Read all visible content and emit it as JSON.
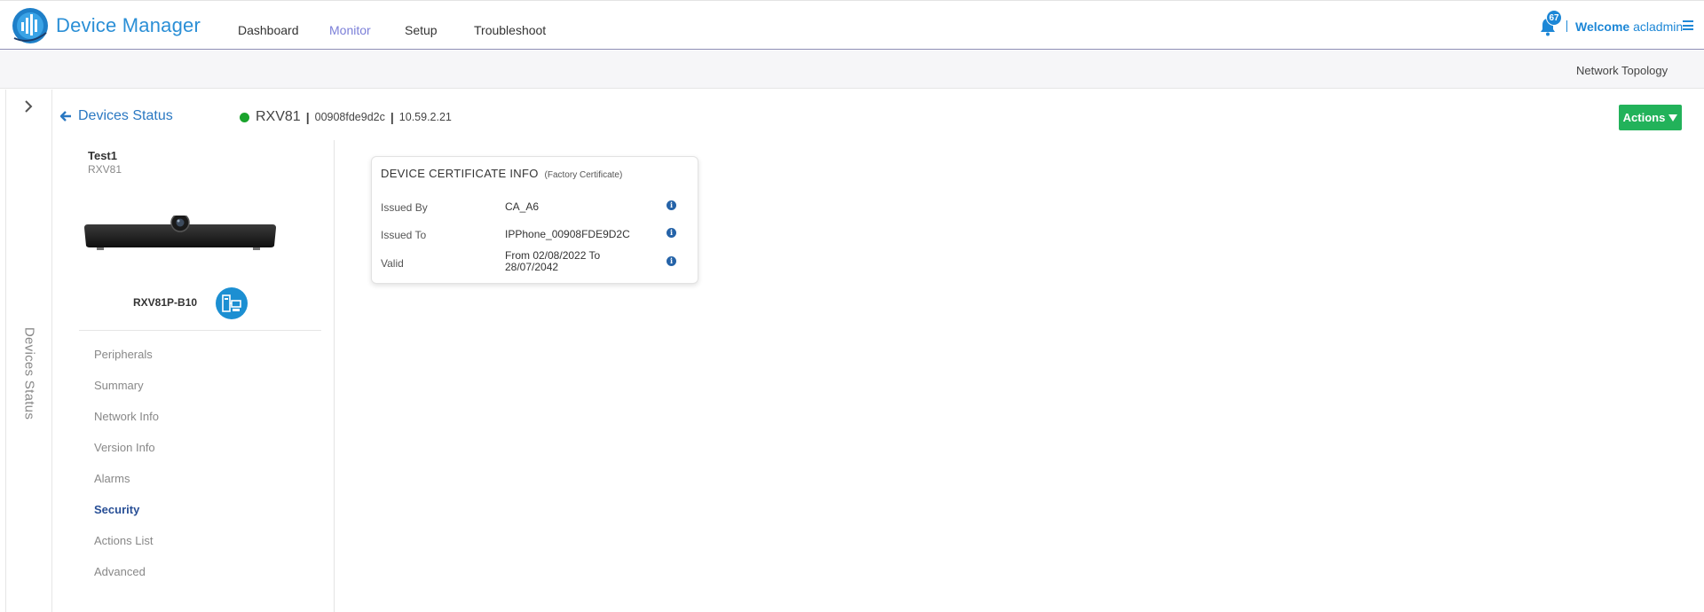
{
  "app": {
    "title": "Device Manager"
  },
  "nav": [
    {
      "label": "Dashboard",
      "active": false
    },
    {
      "label": "Monitor",
      "active": true
    },
    {
      "label": "Setup",
      "active": false
    },
    {
      "label": "Troubleshoot",
      "active": false
    }
  ],
  "header": {
    "notification_count": "67",
    "welcome_prefix": "Welcome",
    "username": "acladmin"
  },
  "subbar": {
    "network_topology": "Network Topology"
  },
  "rail": {
    "label": "Devices Status"
  },
  "page": {
    "back_label": "Devices Status",
    "device_name": "RXV81",
    "mac": "00908fde9d2c",
    "ip": "10.59.2.21",
    "status_color": "#1aa32c",
    "actions_label": "Actions"
  },
  "device": {
    "label": "Test1",
    "model_short": "RXV81",
    "model_full": "RXV81P-B10"
  },
  "menu": [
    {
      "label": "Peripherals",
      "active": false
    },
    {
      "label": "Summary",
      "active": false
    },
    {
      "label": "Network Info",
      "active": false
    },
    {
      "label": "Version Info",
      "active": false
    },
    {
      "label": "Alarms",
      "active": false
    },
    {
      "label": "Security",
      "active": true
    },
    {
      "label": "Actions List",
      "active": false
    },
    {
      "label": "Advanced",
      "active": false
    }
  ],
  "certificate": {
    "title": "DEVICE CERTIFICATE INFO",
    "subtitle": "(Factory Certificate)",
    "rows": [
      {
        "key": "Issued By",
        "value": "CA_A6"
      },
      {
        "key": "Issued To",
        "value": "IPPhone_00908FDE9D2C"
      },
      {
        "key": "Valid",
        "value": "From 02/08/2022 To 28/07/2042"
      }
    ]
  },
  "colors": {
    "brand": "#2b8fd6",
    "active_nav": "#7b7fd8",
    "actions_button": "#22b25a",
    "active_menu": "#284f96"
  }
}
